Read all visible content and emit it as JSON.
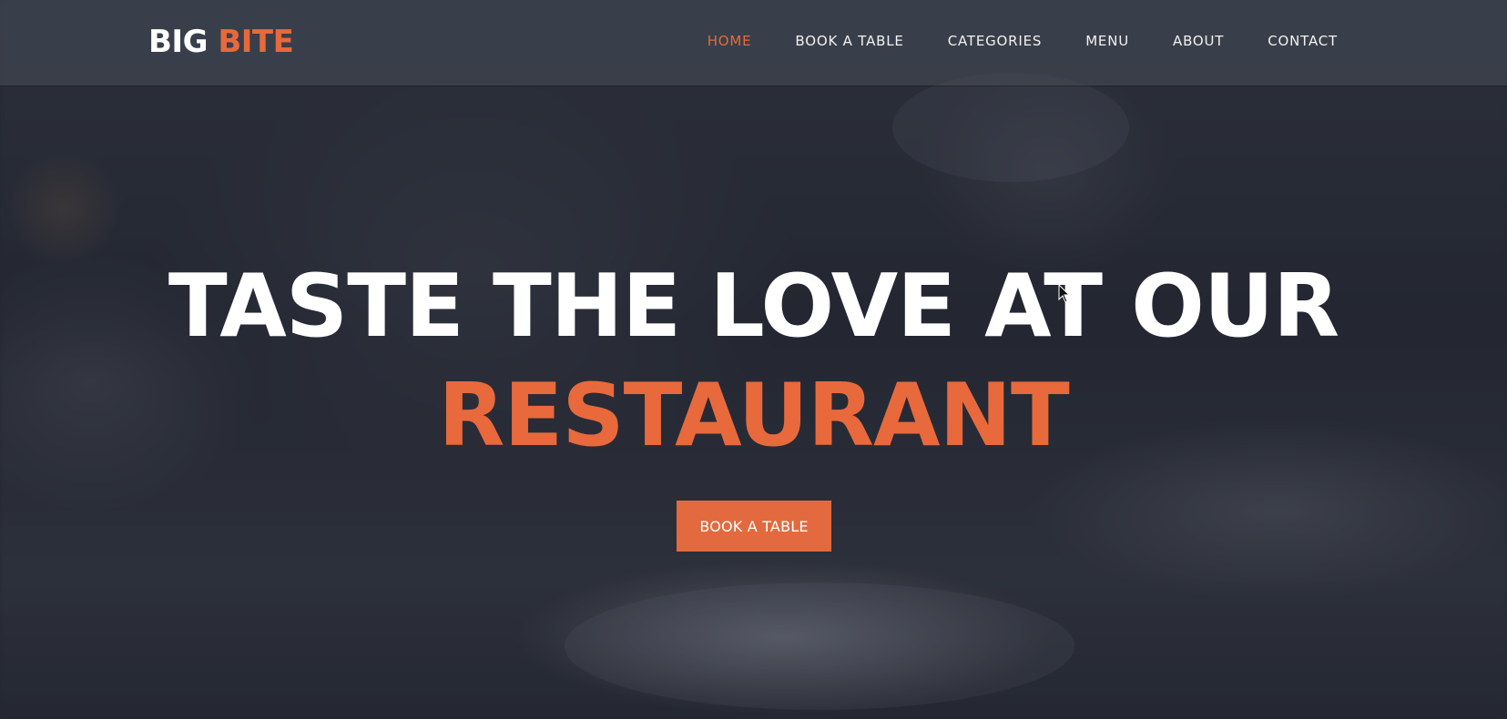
{
  "brand": {
    "name_part1": "BIG",
    "name_part2": "BITE",
    "accent_color": "#e8693c"
  },
  "nav": {
    "items": [
      {
        "label": "HOME",
        "active": true
      },
      {
        "label": "BOOK A TABLE",
        "active": false
      },
      {
        "label": "CATEGORIES",
        "active": false
      },
      {
        "label": "MENU",
        "active": false
      },
      {
        "label": "ABOUT",
        "active": false
      },
      {
        "label": "CONTACT",
        "active": false
      }
    ]
  },
  "hero": {
    "headline_line1": "TASTE THE LOVE AT OUR",
    "headline_line2": "RESTAURANT",
    "cta_label": "BOOK A TABLE"
  },
  "colors": {
    "accent": "#e8693c",
    "button": "#e36a3e",
    "text": "#ffffff"
  }
}
